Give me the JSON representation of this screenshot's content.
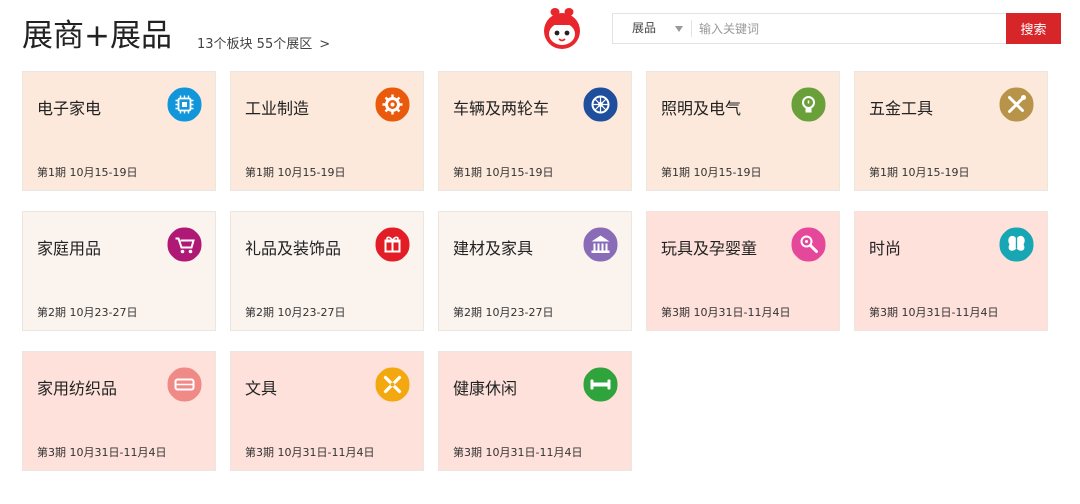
{
  "header": {
    "title": "展商+展品",
    "summary": "13个板块 55个展区",
    "summary_chevron": ">"
  },
  "search": {
    "category": "展品",
    "placeholder": "输入关键词",
    "button_label": "搜索"
  },
  "colors": {
    "accent": "#d7262a",
    "phase1_bg": "#fde9dc",
    "phase2_bg": "#faf3ee",
    "phase3_bg": "#fde1da"
  },
  "sectors": [
    {
      "name": "电子家电",
      "date": "第1期 10月15-19日",
      "icon": "chip-icon",
      "icon_color": "#1296db",
      "phase": 1
    },
    {
      "name": "工业制造",
      "date": "第1期 10月15-19日",
      "icon": "gear-icon",
      "icon_color": "#ea5a0c",
      "phase": 1
    },
    {
      "name": "车辆及两轮车",
      "date": "第1期 10月15-19日",
      "icon": "wheel-icon",
      "icon_color": "#1f4e9c",
      "phase": 1
    },
    {
      "name": "照明及电气",
      "date": "第1期 10月15-19日",
      "icon": "bulb-icon",
      "icon_color": "#6aa03a",
      "phase": 1
    },
    {
      "name": "五金工具",
      "date": "第1期 10月15-19日",
      "icon": "tools-icon",
      "icon_color": "#b8944a",
      "phase": 1
    },
    {
      "name": "家庭用品",
      "date": "第2期 10月23-27日",
      "icon": "cart-icon",
      "icon_color": "#b01876",
      "phase": 2
    },
    {
      "name": "礼品及装饰品",
      "date": "第2期 10月23-27日",
      "icon": "gift-icon",
      "icon_color": "#e21d26",
      "phase": 2
    },
    {
      "name": "建材及家具",
      "date": "第2期 10月23-27日",
      "icon": "building-icon",
      "icon_color": "#8a6bb8",
      "phase": 2
    },
    {
      "name": "玩具及孕婴童",
      "date": "第3期 10月31日-11月4日",
      "icon": "rattle-icon",
      "icon_color": "#e5489a",
      "phase": 3
    },
    {
      "name": "时尚",
      "date": "第3期 10月31日-11月4日",
      "icon": "butterfly-icon",
      "icon_color": "#16a6b4",
      "phase": 3
    },
    {
      "name": "家用纺织品",
      "date": "第3期 10月31日-11月4日",
      "icon": "textile-icon",
      "icon_color": "#f08a86",
      "phase": 3
    },
    {
      "name": "文具",
      "date": "第3期 10月31日-11月4日",
      "icon": "stationery-icon",
      "icon_color": "#f4a80f",
      "phase": 3
    },
    {
      "name": "健康休闲",
      "date": "第3期 10月31日-11月4日",
      "icon": "fitness-icon",
      "icon_color": "#2fa33c",
      "phase": 3
    }
  ]
}
